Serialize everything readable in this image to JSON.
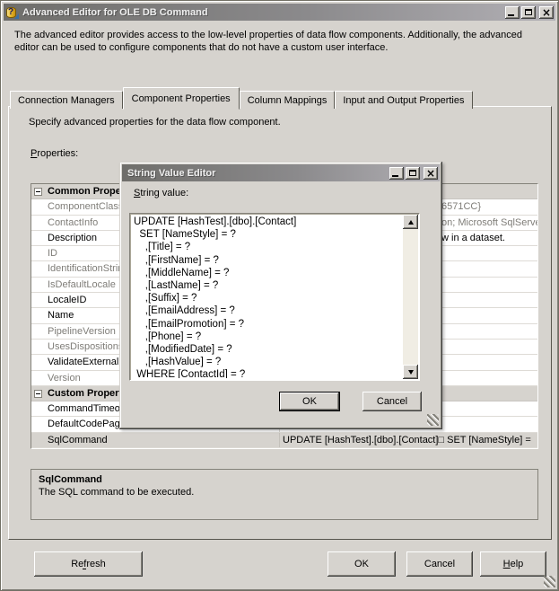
{
  "window": {
    "title": "Advanced Editor for OLE DB Command",
    "intro": "The advanced editor provides access to the low-level properties of data flow components. Additionally, the advanced editor can be used to configure components that do not have a custom user interface."
  },
  "tabs": {
    "connection_managers": "Connection Managers",
    "component_properties": "Component Properties",
    "column_mappings": "Column Mappings",
    "input_output": "Input and Output Properties"
  },
  "page": {
    "instruction": "Specify advanced properties for the data flow component.",
    "properties_label": "Properties:"
  },
  "grid": {
    "rows": [
      {
        "name": "Common Properties",
        "type": "category"
      },
      {
        "name": "ComponentClassID",
        "value": "6571CC}"
      },
      {
        "name": "ContactInfo",
        "value": "on; Microsoft SqlServe"
      },
      {
        "name": "Description",
        "value": "w in a dataset."
      },
      {
        "name": "ID",
        "value": ""
      },
      {
        "name": "IdentificationString",
        "value": ""
      },
      {
        "name": "IsDefaultLocale",
        "value": ""
      },
      {
        "name": "LocaleID",
        "value": ""
      },
      {
        "name": "Name",
        "value": ""
      },
      {
        "name": "PipelineVersion",
        "value": ""
      },
      {
        "name": "UsesDispositions",
        "value": ""
      },
      {
        "name": "ValidateExternalMetadata",
        "value": ""
      },
      {
        "name": "Version",
        "value": ""
      },
      {
        "name": "Custom Properties",
        "type": "category"
      },
      {
        "name": "CommandTimeout",
        "value": ""
      },
      {
        "name": "DefaultCodePage",
        "value": ""
      },
      {
        "name": "SqlCommand",
        "value": "UPDATE [HashTest].[dbo].[Contact]□  SET [NameStyle] =",
        "selected": true
      }
    ]
  },
  "detail": {
    "title": "SqlCommand",
    "text": "The SQL command to be executed."
  },
  "footer": {
    "refresh": "Refresh",
    "ok": "OK",
    "cancel": "Cancel",
    "help": "Help"
  },
  "editor": {
    "title": "String Value Editor",
    "label": "String value:",
    "value": "UPDATE [HashTest].[dbo].[Contact]\n  SET [NameStyle] = ?\n    ,[Title] = ?\n    ,[FirstName] = ?\n    ,[MiddleName] = ?\n    ,[LastName] = ?\n    ,[Suffix] = ?\n    ,[EmailAddress] = ?\n    ,[EmailPromotion] = ?\n    ,[Phone] = ?\n    ,[ModifiedDate] = ?\n    ,[HashValue] = ?\n WHERE [ContactId] = ?",
    "ok": "OK",
    "cancel": "Cancel"
  },
  "colors": {
    "dialog_bg": "#d6d3ce",
    "titlebar_dark": "#6f6e6b",
    "titlebar_light": "#b2b0b5",
    "readonly_text": "#7f7d78"
  }
}
